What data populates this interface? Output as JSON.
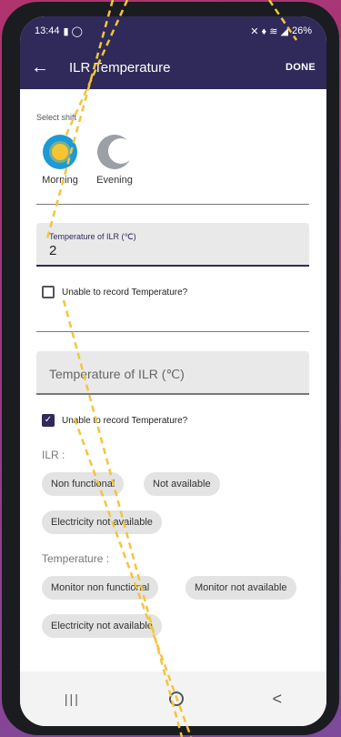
{
  "status_bar": {
    "time": "13:44",
    "left_icons": "▮ ◯",
    "right_icons": "✕ ♦ ≋ ◢",
    "battery": "26%"
  },
  "app_bar": {
    "title": "ILR Temperature",
    "done_label": "DONE"
  },
  "shift": {
    "section_label": "Select shift",
    "options": [
      {
        "label": "Morning",
        "icon": "sun-icon"
      },
      {
        "label": "Evening",
        "icon": "moon-icon"
      }
    ]
  },
  "first_entry": {
    "input_label": "Temperature of ILR (℃)",
    "input_value": "2",
    "unable_checkbox_label": "Unable to record Temperature?",
    "unable_checked": false
  },
  "second_entry": {
    "input_placeholder": "Temperature of ILR (℃)",
    "unable_checkbox_label": "Unable to record Temperature?",
    "unable_checked": true,
    "ilr_label": "ILR :",
    "ilr_chips": [
      "Non functional",
      "Not available",
      "Electricity not available"
    ],
    "temperature_label": "Temperature :",
    "temperature_chips": [
      "Monitor non functional",
      "Monitor not available",
      "Electricity not available"
    ]
  },
  "nav_bar": {
    "recent": "|||",
    "back": "<"
  },
  "colors": {
    "primary": "#2f2a5a",
    "annotation": "#f2c53d"
  }
}
